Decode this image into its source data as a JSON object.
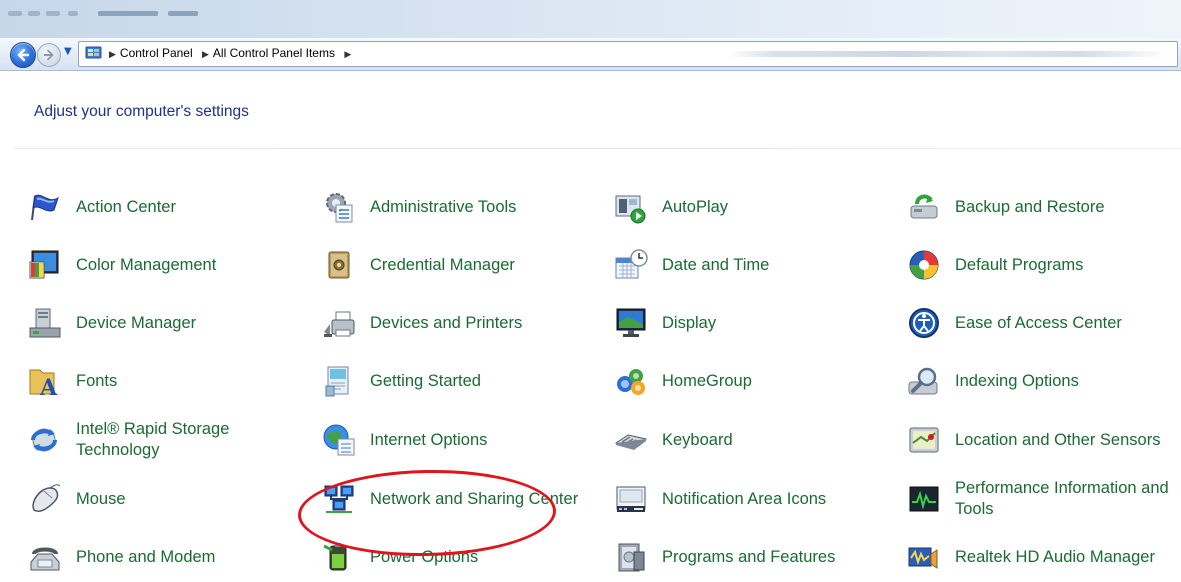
{
  "address_bar": {
    "breadcrumbs": [
      "Control Panel",
      "All Control Panel Items"
    ]
  },
  "heading": "Adjust your computer's settings",
  "items": [
    {
      "label": "Action Center",
      "icon": "flag-icon"
    },
    {
      "label": "Administrative Tools",
      "icon": "admin-tools-icon"
    },
    {
      "label": "AutoPlay",
      "icon": "autoplay-icon"
    },
    {
      "label": "Backup and Restore",
      "icon": "backup-icon"
    },
    {
      "label": "Color Management",
      "icon": "color-management-icon"
    },
    {
      "label": "Credential Manager",
      "icon": "credential-vault-icon"
    },
    {
      "label": "Date and Time",
      "icon": "calendar-clock-icon"
    },
    {
      "label": "Default Programs",
      "icon": "default-programs-icon"
    },
    {
      "label": "Device Manager",
      "icon": "device-manager-icon"
    },
    {
      "label": "Devices and Printers",
      "icon": "printer-icon"
    },
    {
      "label": "Display",
      "icon": "monitor-icon"
    },
    {
      "label": "Ease of Access Center",
      "icon": "ease-of-access-icon"
    },
    {
      "label": "Fonts",
      "icon": "fonts-folder-icon"
    },
    {
      "label": "Getting Started",
      "icon": "getting-started-icon"
    },
    {
      "label": "HomeGroup",
      "icon": "homegroup-icon"
    },
    {
      "label": "Indexing Options",
      "icon": "magnifier-icon"
    },
    {
      "label": "Intel® Rapid Storage Technology",
      "icon": "intel-storage-icon"
    },
    {
      "label": "Internet Options",
      "icon": "globe-icon"
    },
    {
      "label": "Keyboard",
      "icon": "keyboard-icon"
    },
    {
      "label": "Location and Other Sensors",
      "icon": "sensors-icon"
    },
    {
      "label": "Mouse",
      "icon": "mouse-icon"
    },
    {
      "label": "Network and Sharing Center",
      "icon": "network-icon"
    },
    {
      "label": "Notification Area Icons",
      "icon": "notification-area-icon"
    },
    {
      "label": "Performance Information and Tools",
      "icon": "performance-icon"
    },
    {
      "label": "Phone and Modem",
      "icon": "phone-icon"
    },
    {
      "label": "Power Options",
      "icon": "battery-icon"
    },
    {
      "label": "Programs and Features",
      "icon": "programs-icon"
    },
    {
      "label": "Realtek HD Audio Manager",
      "icon": "audio-manager-icon"
    }
  ],
  "highlighted_item": "Network and Sharing Center",
  "colors": {
    "item_text": "#1b6a34",
    "heading_text": "#1e3287",
    "highlight": "#e0141c"
  }
}
